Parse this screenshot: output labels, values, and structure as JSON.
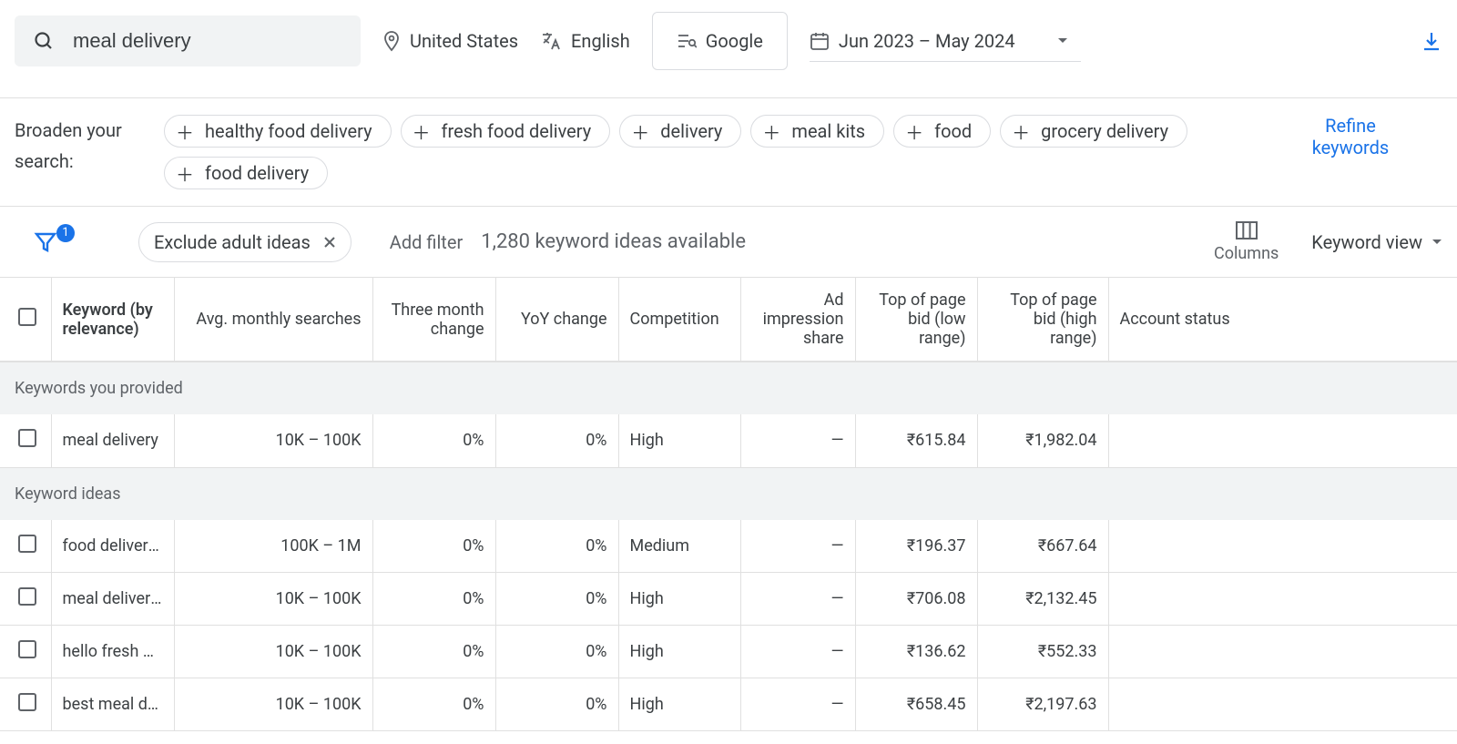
{
  "toolbar": {
    "search_value": "meal delivery",
    "location": "United States",
    "language": "English",
    "network": "Google",
    "date_range": "Jun 2023 – May 2024"
  },
  "broaden": {
    "label": "Broaden your search:",
    "chips": [
      "healthy food delivery",
      "fresh food delivery",
      "delivery",
      "meal kits",
      "food",
      "grocery delivery",
      "food delivery"
    ],
    "refine": "Refine keywords"
  },
  "filter": {
    "badge": "1",
    "pill": "Exclude adult ideas",
    "add_filter": "Add filter",
    "ideas": "1,280 keyword ideas available",
    "columns_label": "Columns",
    "view_label": "Keyword view"
  },
  "columns": {
    "keyword": "Keyword (by relevance)",
    "avg": "Avg. monthly searches",
    "three": "Three month change",
    "yoy": "YoY change",
    "comp": "Competition",
    "imp": "Ad impression share",
    "low": "Top of page bid (low range)",
    "high": "Top of page bid (high range)",
    "status": "Account status"
  },
  "sections": {
    "provided": "Keywords you provided",
    "ideas": "Keyword ideas"
  },
  "rows_provided": [
    {
      "kw": "meal delivery",
      "avg": "10K – 100K",
      "three": "0%",
      "yoy": "0%",
      "comp": "High",
      "imp": "—",
      "low": "₹615.84",
      "high": "₹1,982.04"
    }
  ],
  "rows_ideas": [
    {
      "kw": "food delivery services that accept ebt",
      "avg": "100K – 1M",
      "three": "0%",
      "yoy": "0%",
      "comp": "Medium",
      "imp": "—",
      "low": "₹196.37",
      "high": "₹667.64"
    },
    {
      "kw": "meal delivery service",
      "avg": "10K – 100K",
      "three": "0%",
      "yoy": "0%",
      "comp": "High",
      "imp": "—",
      "low": "₹706.08",
      "high": "₹2,132.45"
    },
    {
      "kw": "hello fresh meals",
      "avg": "10K – 100K",
      "three": "0%",
      "yoy": "0%",
      "comp": "High",
      "imp": "—",
      "low": "₹136.62",
      "high": "₹552.33"
    },
    {
      "kw": "best meal delivery service",
      "avg": "10K – 100K",
      "three": "0%",
      "yoy": "0%",
      "comp": "High",
      "imp": "—",
      "low": "₹658.45",
      "high": "₹2,197.63"
    }
  ]
}
